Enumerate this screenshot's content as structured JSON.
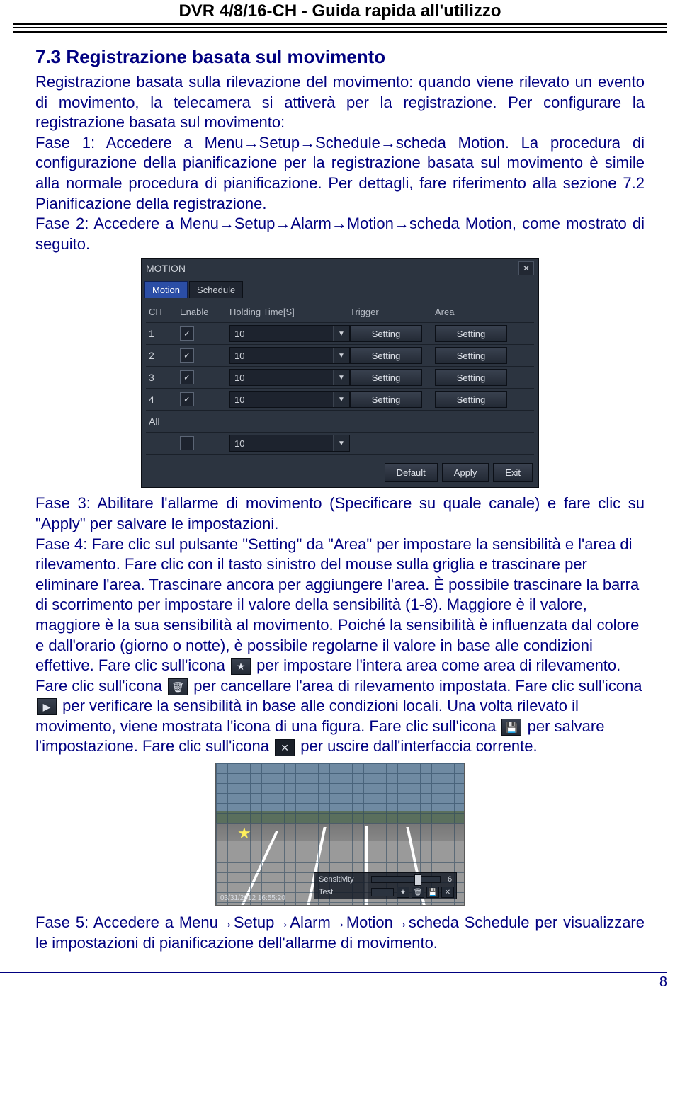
{
  "header": "DVR 4/8/16-CH - Guida rapida all'utilizzo",
  "section_title": "7.3 Registrazione basata sul movimento",
  "p1": "Registrazione basata sulla rilevazione del movimento: quando viene rilevato un evento di movimento, la telecamera si attiverà per la registrazione. Per configurare la registrazione basata sul movimento:",
  "fase1": "Fase 1: Accedere a Menu→Setup→Schedule→scheda Motion. La procedura di configurazione della pianificazione per la registrazione basata sul movimento è simile alla normale procedura di pianificazione. Per dettagli, fare riferimento alla sezione 7.2 Pianificazione della registrazione.",
  "fase2": "Fase 2: Accedere a Menu→Setup→Alarm→Motion→scheda Motion, come mostrato di seguito.",
  "motion": {
    "title": "MOTION",
    "tabs": [
      "Motion",
      "Schedule"
    ],
    "cols": {
      "ch": "CH",
      "en": "Enable",
      "ht": "Holding Time[S]",
      "tr": "Trigger",
      "ar": "Area"
    },
    "rows": [
      {
        "ch": "1",
        "ht": "10",
        "tr": "Setting",
        "ar": "Setting"
      },
      {
        "ch": "2",
        "ht": "10",
        "tr": "Setting",
        "ar": "Setting"
      },
      {
        "ch": "3",
        "ht": "10",
        "tr": "Setting",
        "ar": "Setting"
      },
      {
        "ch": "4",
        "ht": "10",
        "tr": "Setting",
        "ar": "Setting"
      }
    ],
    "all": {
      "label": "All",
      "ht": "10"
    },
    "footer": {
      "default": "Default",
      "apply": "Apply",
      "exit": "Exit"
    }
  },
  "fase3": "Fase 3: Abilitare l'allarme di movimento (Specificare su quale canale) e fare clic su \"Apply\" per salvare le impostazioni.",
  "fase4_a": "Fase 4: Fare clic sul pulsante \"Setting\" da \"Area\" per impostare la sensibilità e l'area di rilevamento. Fare clic con il tasto sinistro del mouse sulla griglia e trascinare per eliminare l'area. Trascinare ancora per aggiungere l'area. È possibile trascinare la barra di scorrimento per impostare il valore della sensibilità (1-8). Maggiore è il valore, maggiore è la sua sensibilità al movimento. Poiché la sensibilità è influenzata dal colore e dall'orario (giorno o notte), è possibile regolarne il valore in base alle condizioni effettive. Fare clic sull'icona ",
  "fase4_b": " per impostare l'intera area come area di rilevamento. Fare clic sull'icona ",
  "fase4_c": " per cancellare l'area di rilevamento impostata. Fare clic sull'icona ",
  "fase4_d": " per verificare la sensibilità in base alle condizioni locali. Una volta rilevato il movimento, viene mostrata l'icona di una figura. Fare clic sull'icona ",
  "fase4_e": " per salvare l'impostazione. Fare clic sull'icona ",
  "fase4_f": " per uscire dall'interfaccia corrente.",
  "thumb": {
    "ts": "03/31/2012 16:55:20",
    "sens": "Sensitivity",
    "sensv": "6",
    "test": "Test"
  },
  "fase5": "Fase 5: Accedere a Menu→Setup→Alarm→Motion→scheda Schedule per visualizzare le impostazioni di pianificazione dell'allarme di movimento.",
  "page_number": "8"
}
